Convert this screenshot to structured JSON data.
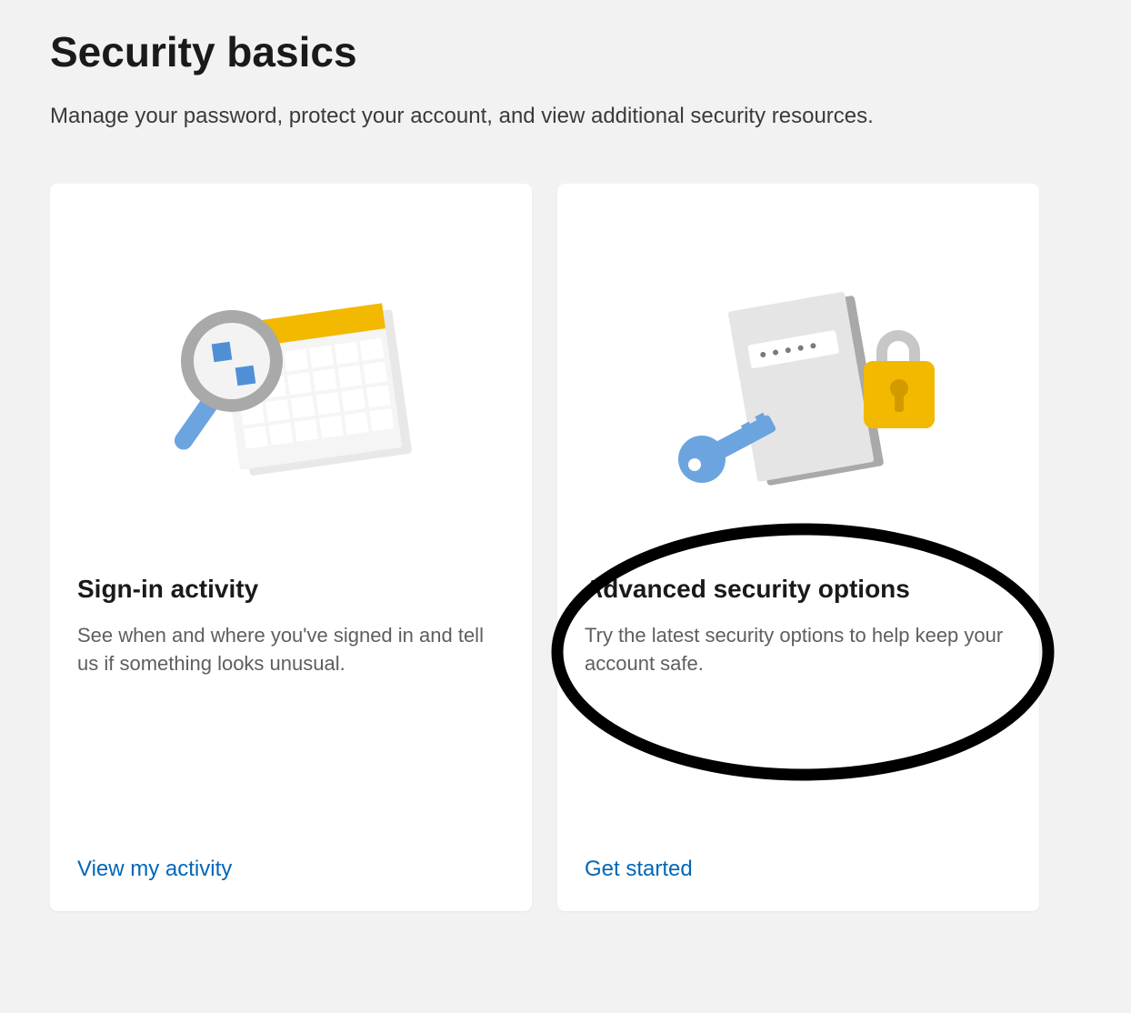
{
  "header": {
    "title": "Security basics",
    "subtitle": "Manage your password, protect your account, and view additional security resources."
  },
  "cards": {
    "signInActivity": {
      "title": "Sign-in activity",
      "description": "See when and where you've signed in and tell us if something looks unusual.",
      "linkLabel": "View my activity"
    },
    "advancedSecurity": {
      "title": "Advanced security options",
      "description": "Try the latest security options to help keep your account safe.",
      "linkLabel": "Get started"
    }
  },
  "colors": {
    "linkBlue": "#0067b8",
    "iconYellow": "#f2b900",
    "iconBlue": "#6ca4e0",
    "iconGrey": "#a9a9a9"
  }
}
